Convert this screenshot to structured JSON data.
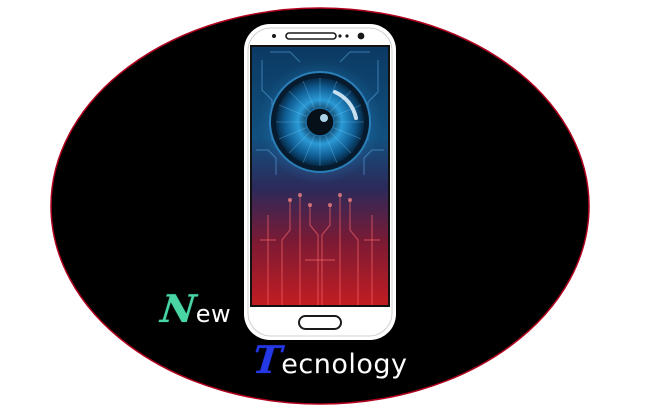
{
  "logo": {
    "line1": {
      "initial": "N",
      "rest": "ew"
    },
    "line2": {
      "initial": "T",
      "rest": "ecnology"
    }
  },
  "colors": {
    "background": "#ffffff",
    "oval_fill": "#000000",
    "oval_outline": "#b0001c",
    "phone_body": "#ffffff",
    "initial_n": "#4ad6a4",
    "initial_t": "#2438e6",
    "screen_top": "#0e4a78",
    "screen_bottom": "#b31b22",
    "eye_iris": "#1b8fd0"
  },
  "icons": [
    "phone-icon",
    "eye-icon",
    "circuit-board-icon",
    "home-button-icon",
    "speaker-grille-icon",
    "front-camera-icon"
  ]
}
